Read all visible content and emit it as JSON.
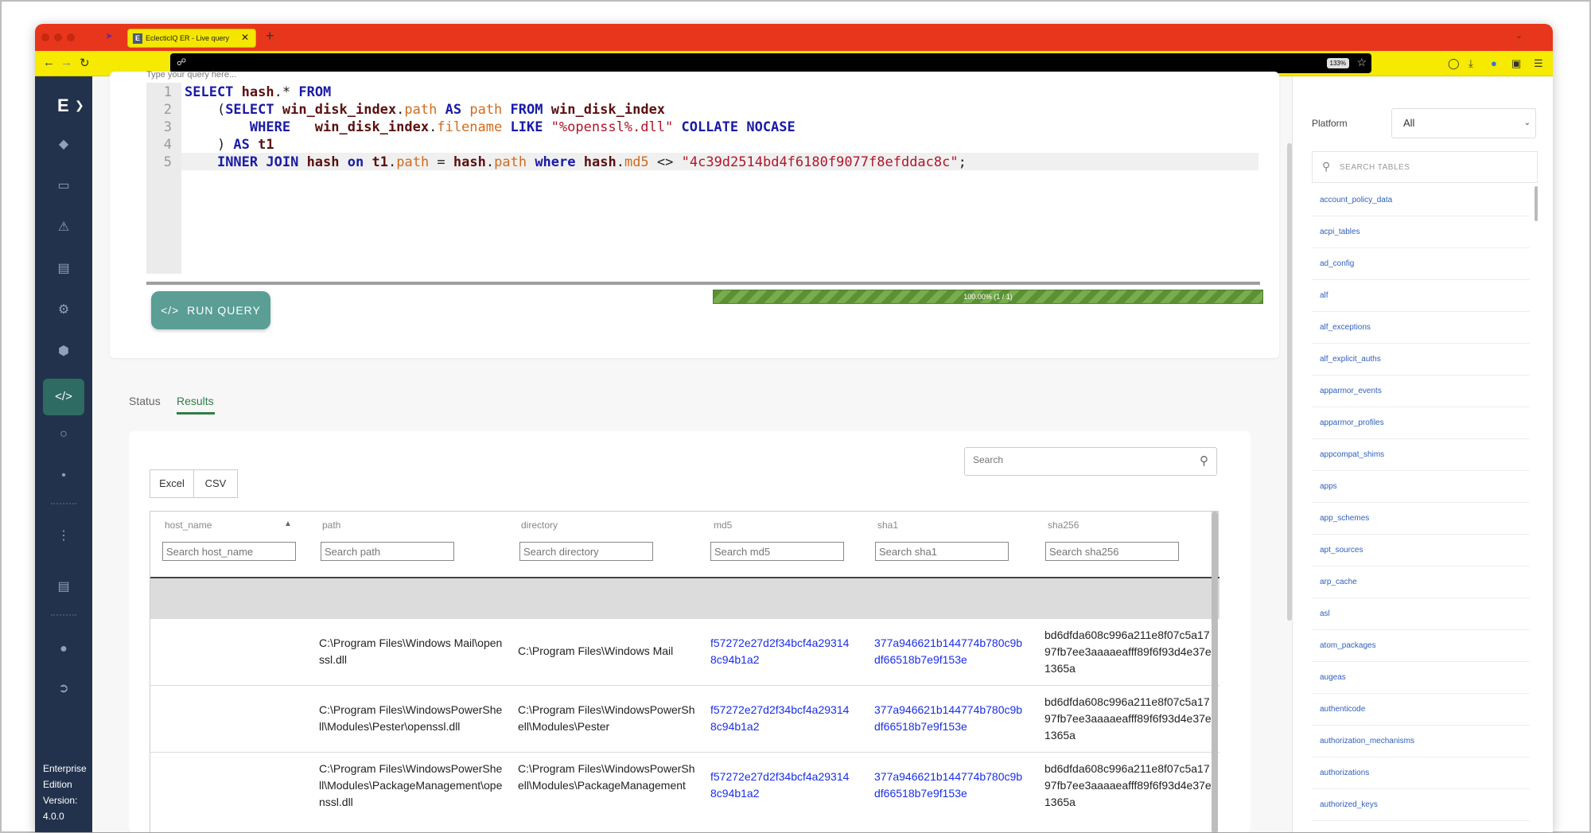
{
  "browser": {
    "tab_title": "EclecticIQ ER - Live query",
    "tab_favicon": "E",
    "zoom": "133%"
  },
  "sidebar": {
    "logo": "E",
    "edition_line1": "Enterprise",
    "edition_line2": "Edition",
    "version_label": "Version:",
    "version": "4.0.0"
  },
  "editor": {
    "hint": "Type your query here...",
    "line_numbers": [
      "1",
      "2",
      "3",
      "4",
      "5"
    ],
    "run_label": "RUN QUERY",
    "progress_text": "100.00% (1 / 1)",
    "progress_value": 1.0
  },
  "tabs": {
    "status": "Status",
    "results": "Results"
  },
  "results": {
    "search_placeholder": "Search",
    "excel_label": "Excel",
    "csv_label": "CSV",
    "columns": [
      "host_name",
      "path",
      "directory",
      "md5",
      "sha1",
      "sha256"
    ],
    "filter_placeholders": [
      "Search host_name",
      "Search path",
      "Search directory",
      "Search md5",
      "Search sha1",
      "Search sha256"
    ],
    "rows": [
      {
        "host_name": "",
        "path": "C:\\Program Files\\Windows Mail\\openssl.dll",
        "directory": "C:\\Program Files\\Windows Mail",
        "md5": "f57272e27d2f34bcf4a293148c94b1a2",
        "sha1": "377a946621b144774b780c9bdf66518b7e9f153e",
        "sha256": "bd6dfda608c996a211e8f07c5a1797fb7ee3aaaaeafff89f6f93d4e37e1365a"
      },
      {
        "host_name": "",
        "path": "C:\\Program Files\\WindowsPowerShell\\Modules\\Pester\\openssl.dll",
        "directory": "C:\\Program Files\\WindowsPowerShell\\Modules\\Pester",
        "md5": "f57272e27d2f34bcf4a293148c94b1a2",
        "sha1": "377a946621b144774b780c9bdf66518b7e9f153e",
        "sha256": "bd6dfda608c996a211e8f07c5a1797fb7ee3aaaaeafff89f6f93d4e37e1365a"
      },
      {
        "host_name": "",
        "path": "C:\\Program Files\\WindowsPowerShell\\Modules\\PackageManagement\\openssl.dll",
        "directory": "C:\\Program Files\\WindowsPowerShell\\Modules\\PackageManagement",
        "md5": "f57272e27d2f34bcf4a293148c94b1a2",
        "sha1": "377a946621b144774b780c9bdf66518b7e9f153e",
        "sha256": "bd6dfda608c996a211e8f07c5a1797fb7ee3aaaaeafff89f6f93d4e37e1365a"
      }
    ]
  },
  "right_panel": {
    "platform_label": "Platform",
    "platform_value": "All",
    "table_search_placeholder": "SEARCH TABLES",
    "tables": [
      "account_policy_data",
      "acpi_tables",
      "ad_config",
      "alf",
      "alf_exceptions",
      "alf_explicit_auths",
      "apparmor_events",
      "apparmor_profiles",
      "appcompat_shims",
      "apps",
      "app_schemes",
      "apt_sources",
      "arp_cache",
      "asl",
      "atom_packages",
      "augeas",
      "authenticode",
      "authorization_mechanisms",
      "authorizations",
      "authorized_keys"
    ]
  }
}
